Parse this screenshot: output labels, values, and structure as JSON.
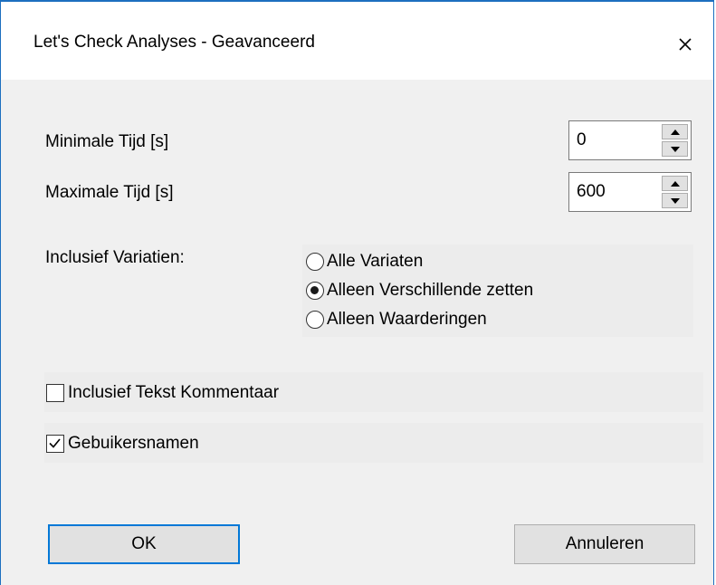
{
  "window": {
    "title": "Let's Check Analyses - Geavanceerd"
  },
  "fields": {
    "min_time": {
      "label": "Minimale Tijd [s]",
      "value": "0"
    },
    "max_time": {
      "label": "Maximale Tijd [s]",
      "value": "600"
    }
  },
  "variations": {
    "label": "Inclusief Variatien:",
    "options": [
      {
        "label": "Alle Variaten",
        "checked": false
      },
      {
        "label": "Alleen Verschillende zetten",
        "checked": true
      },
      {
        "label": "Alleen Waarderingen",
        "checked": false
      }
    ]
  },
  "checkboxes": [
    {
      "label": "Inclusief Tekst Kommentaar",
      "checked": false
    },
    {
      "label": "Gebuikersnamen",
      "checked": true
    }
  ],
  "buttons": {
    "ok": "OK",
    "cancel": "Annuleren"
  },
  "colors": {
    "accent": "#0078d7",
    "window_border": "#1c6fbf",
    "dialog_bg": "#f0f0f0"
  },
  "icons": {
    "close": "close-icon",
    "spin_up": "triangle-up-icon",
    "spin_down": "triangle-down-icon",
    "check": "checkmark-icon"
  }
}
